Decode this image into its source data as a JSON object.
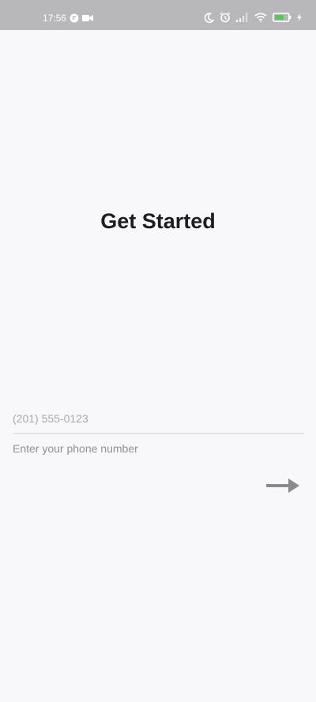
{
  "status_bar": {
    "time": "17:56",
    "icons": [
      "app-notification-icon",
      "video-camera-icon",
      "moon-icon",
      "alarm-icon",
      "signal-icon",
      "wifi-icon",
      "battery-icon",
      "charging-icon"
    ],
    "battery_accent": "#58c65c"
  },
  "screen": {
    "title": "Get Started",
    "phone_input": {
      "placeholder": "(201) 555-0123",
      "value": ""
    },
    "helper_text": "Enter your phone number",
    "next_button": {
      "icon": "arrow-right-icon"
    }
  },
  "colors": {
    "background": "#f8f8fa",
    "status_bar": "#b8b8bb",
    "title": "#1e1e22",
    "arrow": "#8a8a8e"
  }
}
